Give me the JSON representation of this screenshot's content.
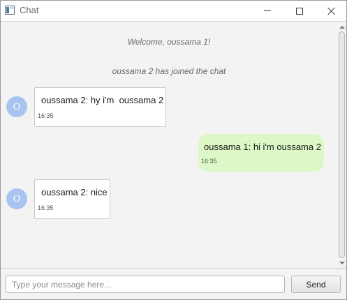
{
  "window": {
    "title": "Chat",
    "icon": "java-app-icon",
    "controls": [
      "minimize-icon",
      "maximize-icon",
      "close-icon"
    ]
  },
  "chat": {
    "system_messages": [
      "Welcome, oussama 1!",
      "oussama 2 has joined the chat"
    ],
    "messages": [
      {
        "direction": "incoming",
        "avatar": "O",
        "text": "oussama 2: hy i'm  oussama 2",
        "time": "16:35"
      },
      {
        "direction": "outgoing",
        "text": "oussama 1: hi i'm oussama 2",
        "time": "16:35"
      },
      {
        "direction": "incoming",
        "avatar": "O",
        "text": "oussama 2: nice",
        "time": "16:35"
      }
    ]
  },
  "composer": {
    "value": "",
    "placeholder": "Type your message here...",
    "send_label": "Send"
  },
  "colors": {
    "outgoing_bubble": "#dcf8c6",
    "incoming_bubble": "#ffffff",
    "avatar": "#a8c4ee",
    "background": "#f3f3f3"
  }
}
